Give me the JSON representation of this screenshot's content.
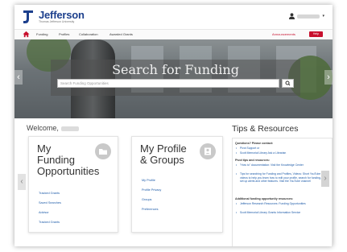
{
  "header": {
    "brand": "Jefferson",
    "brand_sub": "Thomas Jefferson University",
    "user_caret": "▾"
  },
  "nav": {
    "items": [
      "Funding",
      "Profiles",
      "Collaboration",
      "Awarded Grants"
    ],
    "announcements": "Announcements",
    "help": "Help"
  },
  "hero": {
    "title": "Search for Funding",
    "search_placeholder": "Search Funding Opportunities",
    "left_arrow": "‹",
    "right_arrow": "›"
  },
  "welcome": {
    "label": "Welcome,"
  },
  "cards": {
    "funding": {
      "title_line1": "My",
      "title_line2": "Funding",
      "title_line3": "Opportunities",
      "links": [
        "Tracked Grants",
        "Saved Searches",
        "Advisor",
        "Tracked Grants"
      ]
    },
    "profile": {
      "title_line1": "My Profile",
      "title_line2": "& Groups",
      "links": [
        "My Profile",
        "Profile Privacy",
        "Groups",
        "Preferences"
      ]
    },
    "nav_left": "‹"
  },
  "tips": {
    "title": "Tips & Resources",
    "nav_right": "›",
    "sections": [
      {
        "heading": "Questions? Please contact:",
        "items": [
          "Pivot Support or",
          "Scott Memorial Library Ask a Librarian"
        ]
      },
      {
        "heading": "Pivot tips and resources:",
        "items": [
          "\"How to\" documentation: Visit the Knowledge Center",
          "Tips for searching for Funding and Profiles, Videos: Short YouTube videos to help you learn how to edit your profile, search for funding, set up alerts and other features. Visit the YouTube channel"
        ]
      },
      {
        "heading": "Additional funding opportunity resources:",
        "items": [
          "Jefferson Research Resources: Funding Opportunities",
          "Scott Memorial Library Grants Information Service"
        ]
      }
    ]
  },
  "colors": {
    "brand_blue": "#1c3f8c",
    "link_blue": "#1c5aa8",
    "accent_red": "#c8102e"
  }
}
